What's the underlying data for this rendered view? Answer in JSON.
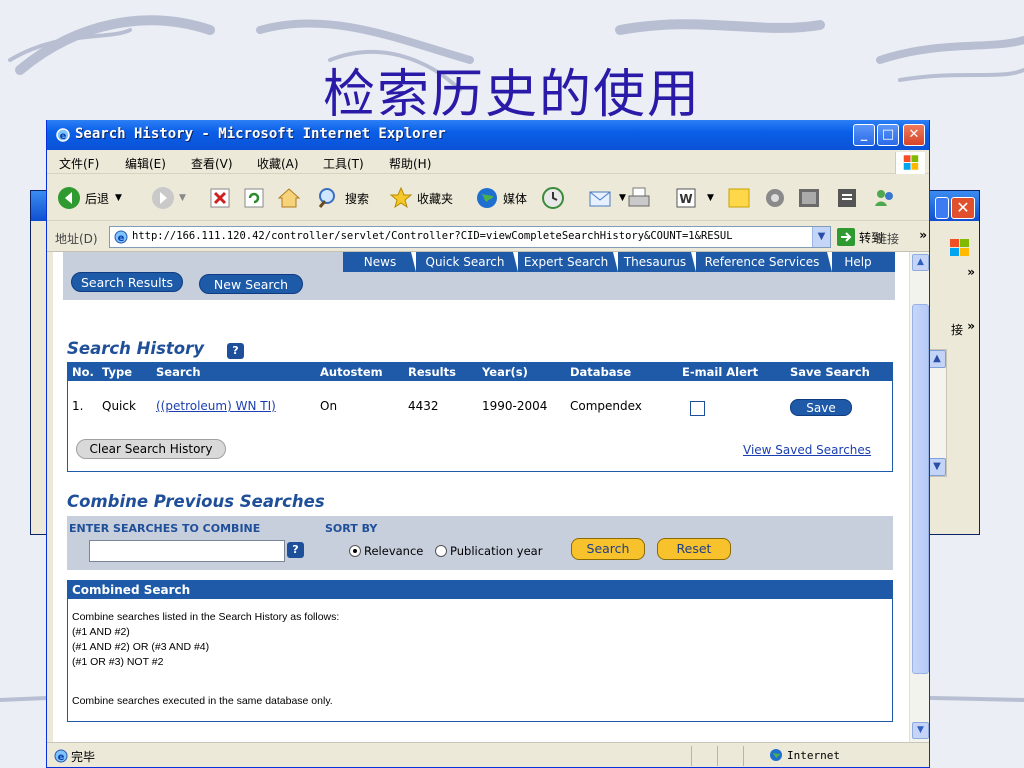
{
  "slide": {
    "title": "检索历史的使用"
  },
  "back_window": {
    "links_label": "接",
    "chevron": "»"
  },
  "window": {
    "title": "Search History - Microsoft Internet Explorer",
    "controls": {
      "minimize": "_",
      "maximize": "□",
      "close": "✕"
    },
    "menu": [
      "文件(F)",
      "编辑(E)",
      "查看(V)",
      "收藏(A)",
      "工具(T)",
      "帮助(H)"
    ],
    "toolbar": {
      "back": "后退",
      "search": "搜索",
      "favorites": "收藏夹",
      "media": "媒体",
      "more": "»"
    },
    "address": {
      "label": "地址(D)",
      "url": "http://166.111.120.42/controller/servlet/Controller?CID=viewCompleteSearchHistory&COUNT=1&RESUL",
      "go": "转到",
      "links": "链接",
      "more": "»"
    },
    "status": {
      "text": "完毕",
      "zone": "Internet"
    }
  },
  "page": {
    "top_nav": [
      "News",
      "Quick Search",
      "Expert Search",
      "Thesaurus",
      "Reference Services",
      "Help"
    ],
    "pills": {
      "search_results": "Search Results",
      "new_search": "New Search"
    },
    "history": {
      "heading": "Search History",
      "help": "?",
      "columns": [
        "No.",
        "Type",
        "Search",
        "Autostem",
        "Results",
        "Year(s)",
        "Database",
        "E-mail Alert",
        "Save Search"
      ],
      "rows": [
        {
          "no": "1.",
          "type": "Quick",
          "search": "((petroleum) WN TI)",
          "autostem": "On",
          "results": "4432",
          "years": "1990-2004",
          "database": "Compendex",
          "email_alert": false,
          "save": "Save"
        }
      ],
      "clear": "Clear Search History",
      "view_saved": "View Saved Searches"
    },
    "combine": {
      "heading": "Combine Previous Searches",
      "enter_label": "ENTER SEARCHES TO COMBINE",
      "sort_label": "SORT BY",
      "input_value": "",
      "help": "?",
      "sort_options": [
        "Relevance",
        "Publication year"
      ],
      "sort_selected": "Relevance",
      "search_btn": "Search",
      "reset_btn": "Reset"
    },
    "combined_search": {
      "heading": "Combined Search",
      "lines": [
        "Combine searches listed in the Search History as follows:",
        "(#1 AND #2)",
        "(#1 AND #2) OR (#3 AND #4)",
        "(#1 OR #3) NOT #2",
        "Combine searches executed in the same database only."
      ]
    }
  }
}
